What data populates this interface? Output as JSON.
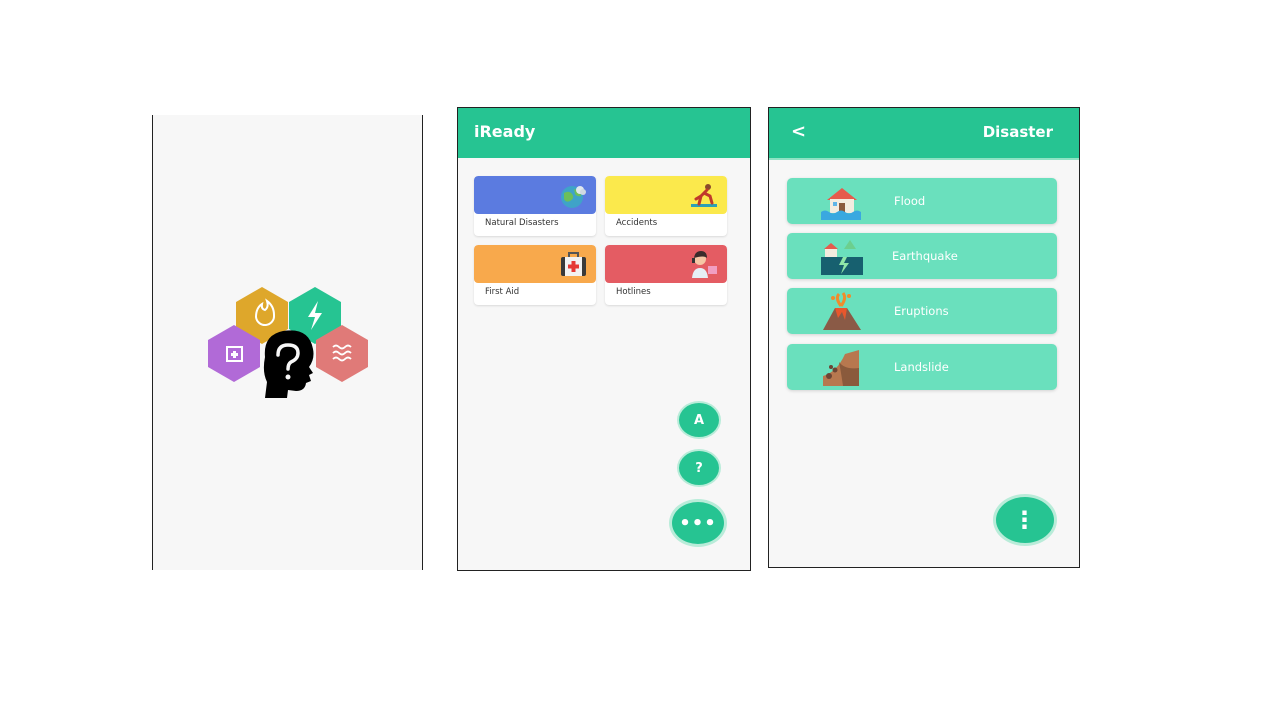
{
  "home": {
    "title": "iReady",
    "cards": [
      {
        "label": "Natural Disasters",
        "color": "#5b7be0",
        "icon": "globe-disaster-icon"
      },
      {
        "label": "Accidents",
        "color": "#fbe94c",
        "icon": "slipping-person-icon"
      },
      {
        "label": "First Aid",
        "color": "#f8a94c",
        "icon": "first-aid-kit-icon"
      },
      {
        "label": "Hotlines",
        "color": "#e45c63",
        "icon": "hotline-operator-icon"
      }
    ],
    "fab_a": "A",
    "fab_help": "?",
    "fab_more": "•••"
  },
  "disaster": {
    "back": "<",
    "title": "Disaster",
    "items": [
      {
        "label": "Flood",
        "icon": "flood-house-icon"
      },
      {
        "label": "Earthquake",
        "icon": "earthquake-icon"
      },
      {
        "label": "Eruptions",
        "icon": "volcano-icon"
      },
      {
        "label": "Landslide",
        "icon": "landslide-icon"
      }
    ],
    "fab_menu": "⋮"
  },
  "colors": {
    "accent": "#26c492",
    "list_item": "#6ae0bd",
    "hex_fire": "#dea72b",
    "hex_power": "#26c492",
    "hex_aid": "#b16ad7",
    "hex_flood": "#e07a78"
  }
}
